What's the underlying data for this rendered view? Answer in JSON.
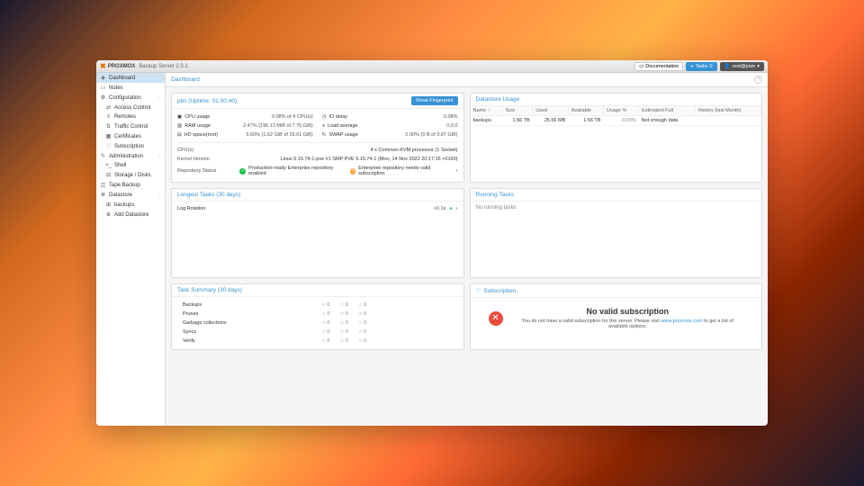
{
  "topbar": {
    "product": "PROXMOX",
    "subtitle": "Backup Server 2.3-1",
    "doc": "Documentation",
    "tasks_label": "Tasks",
    "tasks_count": "0",
    "user": "root@pam"
  },
  "sidebar": [
    {
      "icon": "◈",
      "label": "Dashboard",
      "active": true
    },
    {
      "icon": "▭",
      "label": "Notes"
    },
    {
      "icon": "⚙",
      "label": "Configuration",
      "exp": true
    },
    {
      "icon": "⇄",
      "label": "Access Control",
      "sub": true
    },
    {
      "icon": "≡",
      "label": "Remotes",
      "sub": true
    },
    {
      "icon": "⇅",
      "label": "Traffic Control",
      "sub": true
    },
    {
      "icon": "▦",
      "label": "Certificates",
      "sub": true
    },
    {
      "icon": "♡",
      "label": "Subscription",
      "sub": true
    },
    {
      "icon": "✎",
      "label": "Administration",
      "exp": true
    },
    {
      "icon": ">_",
      "label": "Shell",
      "sub": true
    },
    {
      "icon": "⊟",
      "label": "Storage / Disks",
      "sub": true
    },
    {
      "icon": "◫",
      "label": "Tape Backup"
    },
    {
      "icon": "≣",
      "label": "Datastore",
      "exp": true
    },
    {
      "icon": "⊞",
      "label": "backups",
      "sub": true
    },
    {
      "icon": "⊕",
      "label": "Add Datastore",
      "sub": true
    }
  ],
  "crumb": "Dashboard",
  "host": {
    "title": "pbs (Uptime: 01:00:40)",
    "fingerprint": "Show Fingerprint",
    "stats": [
      [
        {
          "i": "▣",
          "k": "CPU usage",
          "v": "0.08% of 4 CPU(s)"
        },
        {
          "i": "◷",
          "k": "IO delay",
          "v": "0.08%"
        }
      ],
      [
        {
          "i": "▥",
          "k": "RAM usage",
          "v": "2.47% (196.13 MiB of 7.76 GiB)"
        },
        {
          "i": "≡",
          "k": "Load average",
          "v": "0,0,0"
        }
      ],
      [
        {
          "i": "⊟",
          "k": "HD space(root)",
          "v": "5.60% (1.62 GiB of 29.01 GiB)"
        },
        {
          "i": "↻",
          "k": "SWAP usage",
          "v": "0.00% (0 B of 3.87 GiB)"
        }
      ]
    ],
    "info": [
      {
        "k": "CPU(s)",
        "v": "4 x Common KVM processor (1 Socket)"
      },
      {
        "k": "Kernel Version",
        "v": "Linux 5.15.74-1-pve #1 SMP PVE 5.15.74-1 (Mon, 14 Nov 2022 20:17:15 +0100)"
      }
    ],
    "repo_k": "Repository Status",
    "repo_ok": "Production-ready Enterprise repository enabled",
    "repo_warn": "Enterprise repository needs valid subscription"
  },
  "ds": {
    "title": "Datastore Usage",
    "cols": [
      "Name ↑",
      "Size",
      "Used",
      "Available",
      "Usage %",
      "Estimated Full",
      "History (last Month)"
    ],
    "row": {
      "name": "backups",
      "size": "1.56 TB",
      "used": "25.56 MB",
      "avail": "1.56 TB",
      "pct": "0.00%",
      "est": "Not enough data"
    }
  },
  "longest": {
    "title": "Longest Tasks (30 days)",
    "row": {
      "name": "Log Rotation",
      "time": "<0.1s"
    }
  },
  "running": {
    "title": "Running Tasks",
    "empty": "No running tasks"
  },
  "summary": {
    "title": "Task Summary (30 days)",
    "rows": [
      "Backups",
      "Prunes",
      "Garbage collections",
      "Syncs",
      "Verify"
    ]
  },
  "sub": {
    "title": "Subscription",
    "heading": "No valid subscription",
    "text1": "You do not have a valid subscription for this server. Please visit ",
    "link": "www.proxmox.com",
    "text2": " to get a list of available options."
  }
}
